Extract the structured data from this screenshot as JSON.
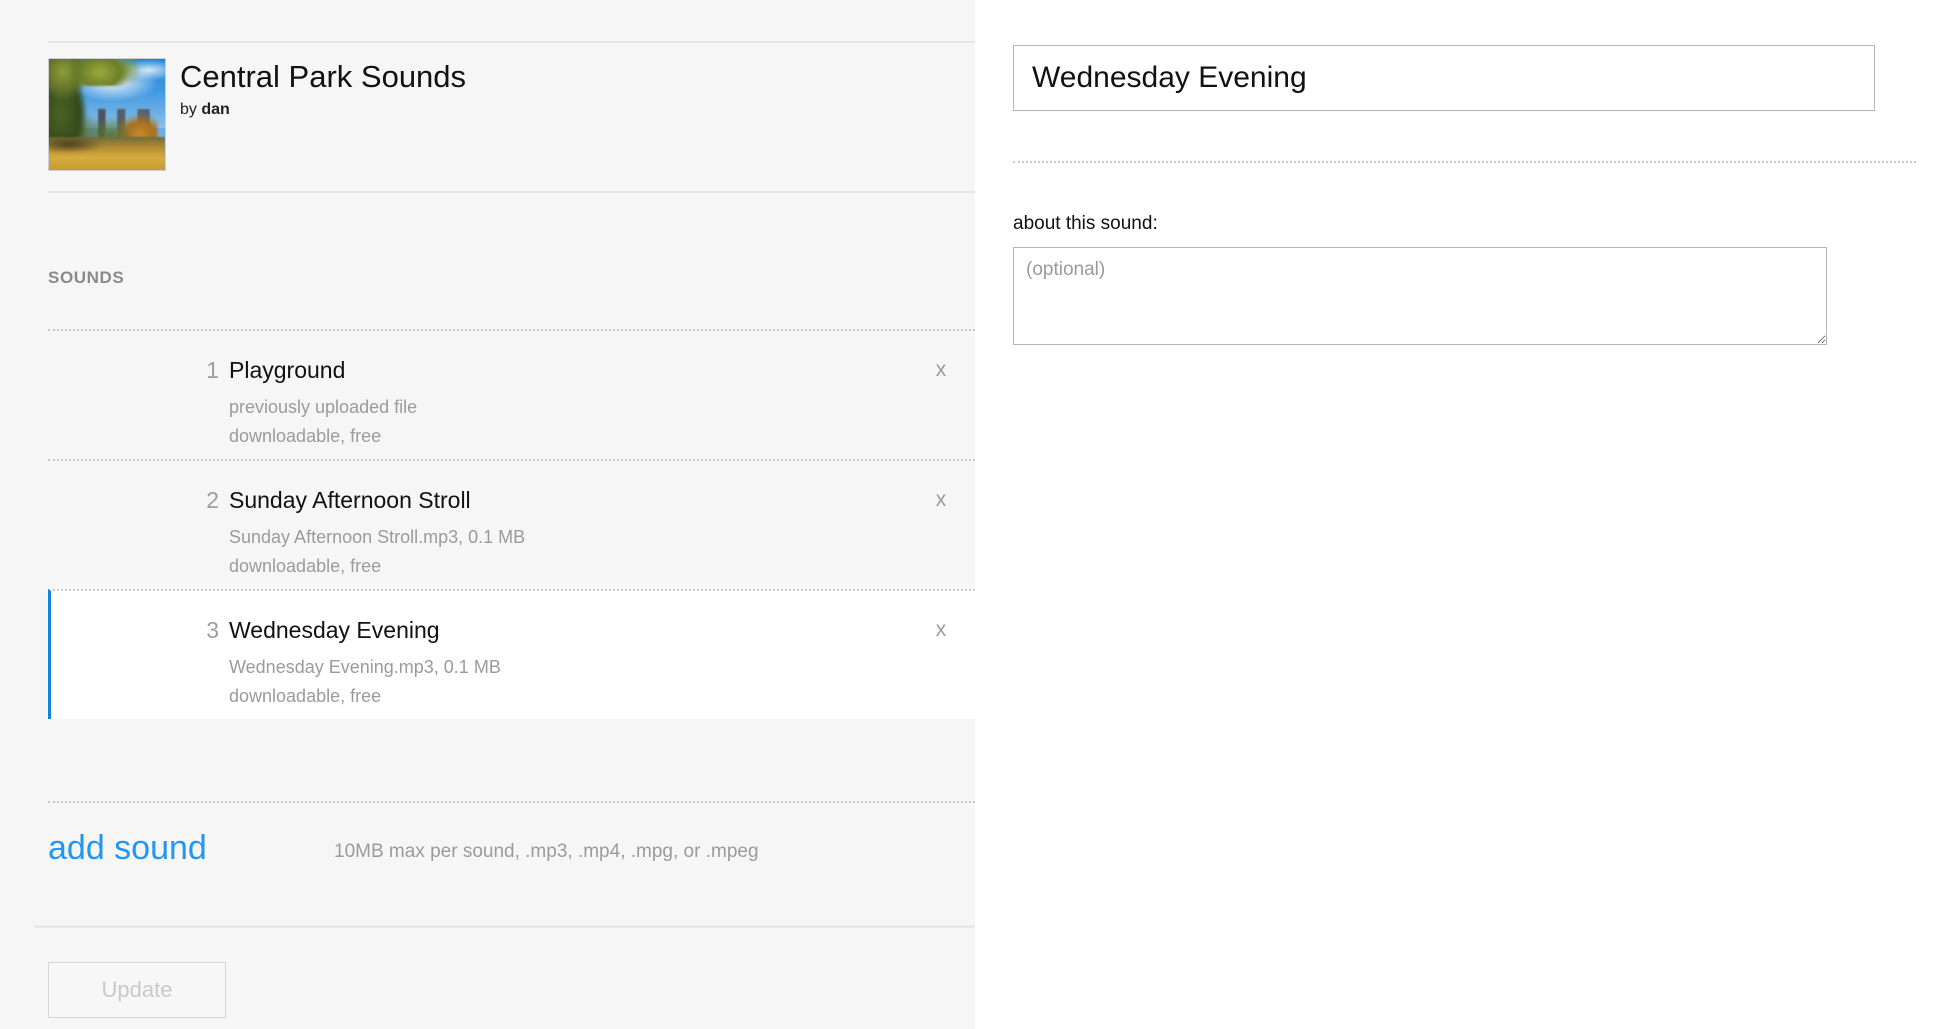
{
  "set": {
    "title": "Central Park Sounds",
    "by_prefix": "by",
    "author": "dan",
    "thumbnail_alt": "central-park-photo"
  },
  "sounds_section": {
    "label": "SOUNDS",
    "remove_label": "x",
    "items": [
      {
        "number": "1",
        "name": "Playground",
        "file_info": "previously uploaded file",
        "availability": "downloadable, free",
        "selected": false
      },
      {
        "number": "2",
        "name": "Sunday Afternoon Stroll",
        "file_info": "Sunday Afternoon Stroll.mp3, 0.1 MB",
        "availability": "downloadable, free",
        "selected": false
      },
      {
        "number": "3",
        "name": "Wednesday Evening",
        "file_info": "Wednesday Evening.mp3, 0.1 MB",
        "availability": "downloadable, free",
        "selected": true
      }
    ]
  },
  "add_sound": {
    "link_label": "add sound",
    "hint": "10MB max per sound, .mp3, .mp4, .mpg, or .mpeg"
  },
  "actions": {
    "update_label": "Update"
  },
  "detail": {
    "title_value": "Wednesday Evening",
    "title_placeholder": "",
    "about_label": "about this sound:",
    "about_value": "",
    "about_placeholder": "(optional)"
  },
  "colors": {
    "accent_blue": "#2196f3",
    "selected_border": "#1184e0",
    "panel_bg": "#f6f6f6",
    "muted_text": "#9b9b9b"
  }
}
